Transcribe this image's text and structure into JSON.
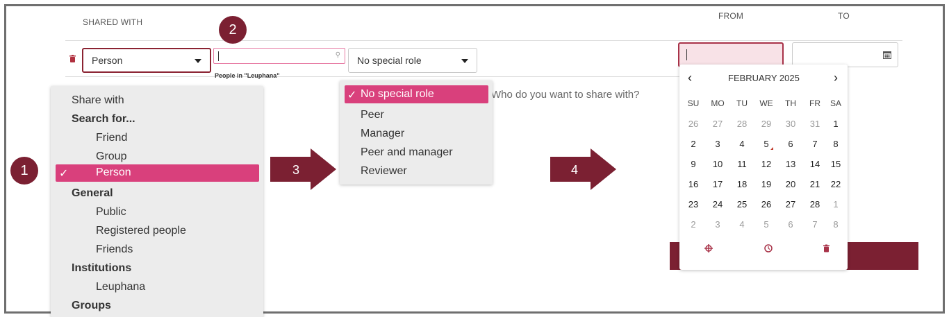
{
  "header": {
    "shared_with": "SHARED WITH",
    "from": "FROM",
    "to": "TO"
  },
  "share_row": {
    "share_type_value": "Person",
    "search_value": "",
    "search_hint": "People in \"Leuphana\"",
    "role_value": "No special role",
    "share_prompt": "Who do you want to share with?"
  },
  "share_dropdown": {
    "items": [
      {
        "label": "Share with",
        "style": "plain"
      },
      {
        "label": "Search for...",
        "style": "group"
      },
      {
        "label": "Friend",
        "style": "option"
      },
      {
        "label": "Group",
        "style": "option"
      },
      {
        "label": "Person",
        "style": "option",
        "selected": true
      },
      {
        "label": "General",
        "style": "group"
      },
      {
        "label": "Public",
        "style": "option"
      },
      {
        "label": "Registered people",
        "style": "option"
      },
      {
        "label": "Friends",
        "style": "option"
      },
      {
        "label": "Institutions",
        "style": "group"
      },
      {
        "label": "Leuphana",
        "style": "option"
      },
      {
        "label": "Groups",
        "style": "group"
      }
    ],
    "check_mark": "✓"
  },
  "role_dropdown": {
    "items": [
      "No special role",
      "Peer",
      "Manager",
      "Peer and manager",
      "Reviewer"
    ],
    "selected_index": 0,
    "check_mark": "✓"
  },
  "callouts": {
    "badge_1": "1",
    "badge_2": "2",
    "arrow_3": "3",
    "arrow_4": "4"
  },
  "calendar": {
    "month_label": "FEBRUARY 2025",
    "prev_icon": "chevron-left-icon",
    "next_icon": "chevron-right-icon",
    "weekdays": [
      "SU",
      "MO",
      "TU",
      "WE",
      "TH",
      "FR",
      "SA"
    ],
    "weeks": [
      [
        {
          "d": "26",
          "dim": true
        },
        {
          "d": "27",
          "dim": true
        },
        {
          "d": "28",
          "dim": true
        },
        {
          "d": "29",
          "dim": true
        },
        {
          "d": "30",
          "dim": true
        },
        {
          "d": "31",
          "dim": true
        },
        {
          "d": "1",
          "dim": false
        }
      ],
      [
        {
          "d": "2",
          "dim": false
        },
        {
          "d": "3",
          "dim": false
        },
        {
          "d": "4",
          "dim": false
        },
        {
          "d": "5",
          "dim": false,
          "today": true
        },
        {
          "d": "6",
          "dim": false
        },
        {
          "d": "7",
          "dim": false
        },
        {
          "d": "8",
          "dim": false
        }
      ],
      [
        {
          "d": "9",
          "dim": false
        },
        {
          "d": "10",
          "dim": false
        },
        {
          "d": "11",
          "dim": false
        },
        {
          "d": "12",
          "dim": false
        },
        {
          "d": "13",
          "dim": false
        },
        {
          "d": "14",
          "dim": false
        },
        {
          "d": "15",
          "dim": false
        }
      ],
      [
        {
          "d": "16",
          "dim": false
        },
        {
          "d": "17",
          "dim": false
        },
        {
          "d": "18",
          "dim": false
        },
        {
          "d": "19",
          "dim": false
        },
        {
          "d": "20",
          "dim": false
        },
        {
          "d": "21",
          "dim": false
        },
        {
          "d": "22",
          "dim": false
        }
      ],
      [
        {
          "d": "23",
          "dim": false
        },
        {
          "d": "24",
          "dim": false
        },
        {
          "d": "25",
          "dim": false
        },
        {
          "d": "26",
          "dim": false
        },
        {
          "d": "27",
          "dim": false
        },
        {
          "d": "28",
          "dim": false
        },
        {
          "d": "1",
          "dim": true
        }
      ],
      [
        {
          "d": "2",
          "dim": true
        },
        {
          "d": "3",
          "dim": true
        },
        {
          "d": "4",
          "dim": true
        },
        {
          "d": "5",
          "dim": true
        },
        {
          "d": "6",
          "dim": true
        },
        {
          "d": "7",
          "dim": true
        },
        {
          "d": "8",
          "dim": true
        }
      ]
    ],
    "footer_icons": [
      "crosshair-icon",
      "clock-icon",
      "trash-icon"
    ]
  },
  "colors": {
    "accent": "#d9407c",
    "brand_maroon": "#7b2032"
  }
}
